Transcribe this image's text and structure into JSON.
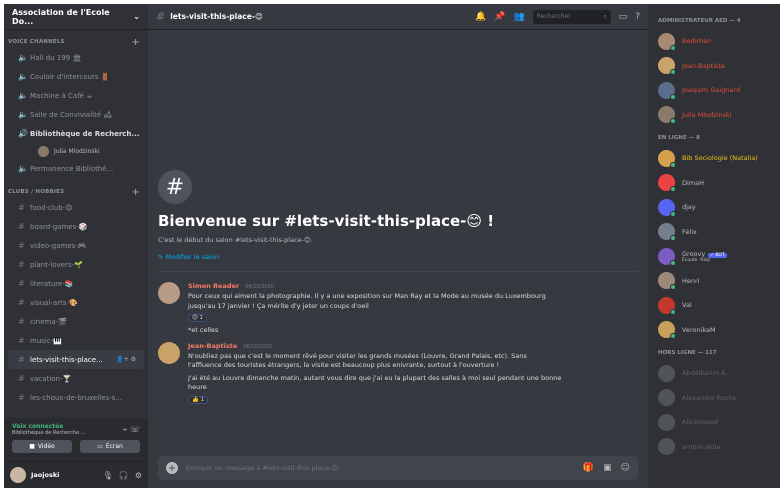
{
  "server": {
    "name": "Association de l'Ecole Do..."
  },
  "voice_category": {
    "label": "VOICE CHANNELS"
  },
  "voice_channels": [
    {
      "label": "Hall du 199 🏛"
    },
    {
      "label": "Couloir d'intercours 🚪"
    },
    {
      "label": "Machine à Café ☕"
    },
    {
      "label": "Salle de Convivialité 🛋"
    },
    {
      "label": "Bibliothèque de Recherch..."
    },
    {
      "label": "Permanence Bibliothé..."
    }
  ],
  "voice_user": {
    "name": "Julia Mlodzinski"
  },
  "clubs_category": {
    "label": "CLUBS / HOBBIES"
  },
  "text_channels": [
    {
      "label": "food-club-😋"
    },
    {
      "label": "board-games-🎲"
    },
    {
      "label": "video-games-🎮"
    },
    {
      "label": "plant-lovers-🌱"
    },
    {
      "label": "literature-📚"
    },
    {
      "label": "visual-arts-🎨"
    },
    {
      "label": "cinema-🎬"
    },
    {
      "label": "music-🎹"
    },
    {
      "label": "lets-visit-this-place..."
    },
    {
      "label": "vacation-🍸"
    },
    {
      "label": "les-choux-de-bruxelles-s..."
    }
  ],
  "voice_panel": {
    "status": "Voix connectée",
    "location": "Bibliothèque de Recherche ...",
    "video_label": "Vidéo",
    "screen_label": "Écran"
  },
  "user": {
    "name": "Jaojoski"
  },
  "channel_header": {
    "title": "lets-visit-this-place-😊",
    "search_placeholder": "Rechercher"
  },
  "welcome": {
    "title": "Bienvenue sur #lets-visit-this-place-😊 !",
    "subtitle": "C'est le début du salon #lets-visit-this-place-😊.",
    "edit_label": "Modifier le salon"
  },
  "messages": [
    {
      "author": "Simon Reader",
      "time": "06/10/2020",
      "lines": [
        "Pour ceux qui aiment la photographie. Il y a une exposition  sur Man Ray et la Mode au musée du Luxembourg",
        "jusqu'au 17 janvier ! Ça mérite d'y jeter un coups d'oeil"
      ],
      "reaction": "😊 1",
      "followup": "*et celles"
    },
    {
      "author": "Jean-Baptiste",
      "time": "06/10/2020",
      "lines": [
        "N'oubliez pas que c'est le moment rêvé pour visiter les grands musées (Louvre, Grand Palais, etc). Sans",
        "l'affluence des touristes étrangers, la visite est beaucoup plus enivrante, surtout à l'ouverture !",
        "J'ai été au Louvre dimanche matin, autant vous dire que j'ai eu la plupart des salles à moi seul pendant une bonne",
        "heure"
      ],
      "reaction": "👍 1"
    }
  ],
  "composer": {
    "placeholder": "Envoyer un message à #lets-visit-this-place-😊"
  },
  "members": {
    "admin_header": "ADMINISTRATEUR AED — 4",
    "admins": [
      {
        "name": "Bedirhan",
        "color": "#e74c3c"
      },
      {
        "name": "Jean-Baptiste",
        "color": "#e74c3c"
      },
      {
        "name": "Joaquim Gaignard",
        "color": "#e74c3c"
      },
      {
        "name": "Julia Mlodzinski",
        "color": "#e74c3c"
      }
    ],
    "online_header": "EN LIGNE — 8",
    "online": [
      {
        "name": "Bib Sociologie (Natalia)",
        "color": "#f1c40f"
      },
      {
        "name": "DimaH",
        "color": "#b9bbbe"
      },
      {
        "name": "djay",
        "color": "#b9bbbe"
      },
      {
        "name": "Félix",
        "color": "#b9bbbe"
      },
      {
        "name": "Groovy",
        "color": "#b9bbbe",
        "badge": "✓ BOT",
        "sub": "Écoute -help"
      },
      {
        "name": "Henri",
        "color": "#b9bbbe"
      },
      {
        "name": "Val",
        "color": "#b9bbbe"
      },
      {
        "name": "VeronikaM",
        "color": "#b9bbbe"
      }
    ],
    "offline_header": "HORS LIGNE — 117",
    "offline": [
      {
        "name": "Abdelkarim A."
      },
      {
        "name": "Alexandre Roche"
      },
      {
        "name": "Alicemeoof"
      },
      {
        "name": "ambre akila"
      }
    ]
  },
  "colors": {
    "background": "#36393f",
    "sidebar": "#2f3136",
    "link": "#00aff4",
    "online_status": "#43b581"
  }
}
